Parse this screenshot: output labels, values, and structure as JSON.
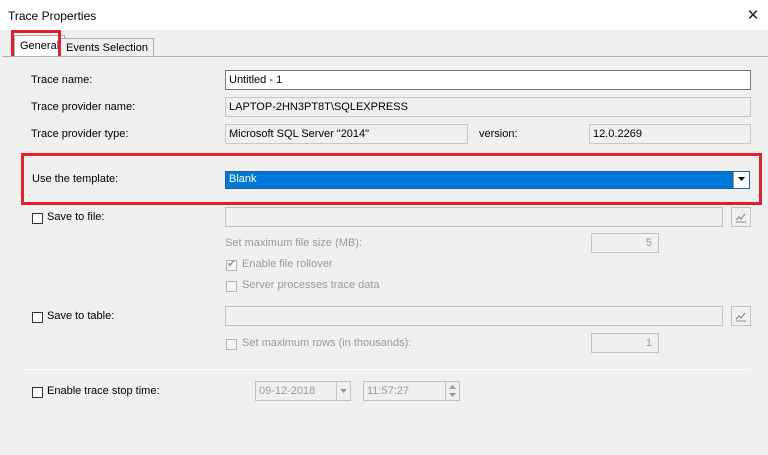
{
  "window": {
    "title": "Trace Properties",
    "close_glyph": "✕"
  },
  "tabs": [
    {
      "label": "General"
    },
    {
      "label": "Events Selection"
    }
  ],
  "general": {
    "trace_name_label": "Trace name:",
    "trace_name_value": "Untitled - 1",
    "provider_name_label": "Trace provider name:",
    "provider_name_value": "LAPTOP-2HN3PT8T\\SQLEXPRESS",
    "provider_type_label": "Trace provider type:",
    "provider_type_value": "Microsoft SQL Server \"2014\"",
    "version_label": "version:",
    "version_value": "12.0.2269",
    "template_label": "Use the template:",
    "template_value": "Blank",
    "save_to_file_label": "Save to file:",
    "max_file_size_label": "Set maximum file size (MB):",
    "max_file_size_value": "5",
    "enable_rollover_label": "Enable file rollover",
    "server_processes_label": "Server processes trace data",
    "save_to_table_label": "Save to table:",
    "max_rows_label": "Set maximum rows (in thousands):",
    "max_rows_value": "1",
    "stop_time_label": "Enable trace stop time:",
    "stop_date_value": "09-12-2018",
    "stop_time_value": "11:57:27"
  },
  "colors": {
    "highlight": "#e0202a",
    "selection": "#0078d7"
  },
  "icons": [
    "close-icon",
    "chevron-down-icon",
    "browse-icon",
    "spin-up-icon",
    "spin-down-icon",
    "checkmark-icon"
  ]
}
